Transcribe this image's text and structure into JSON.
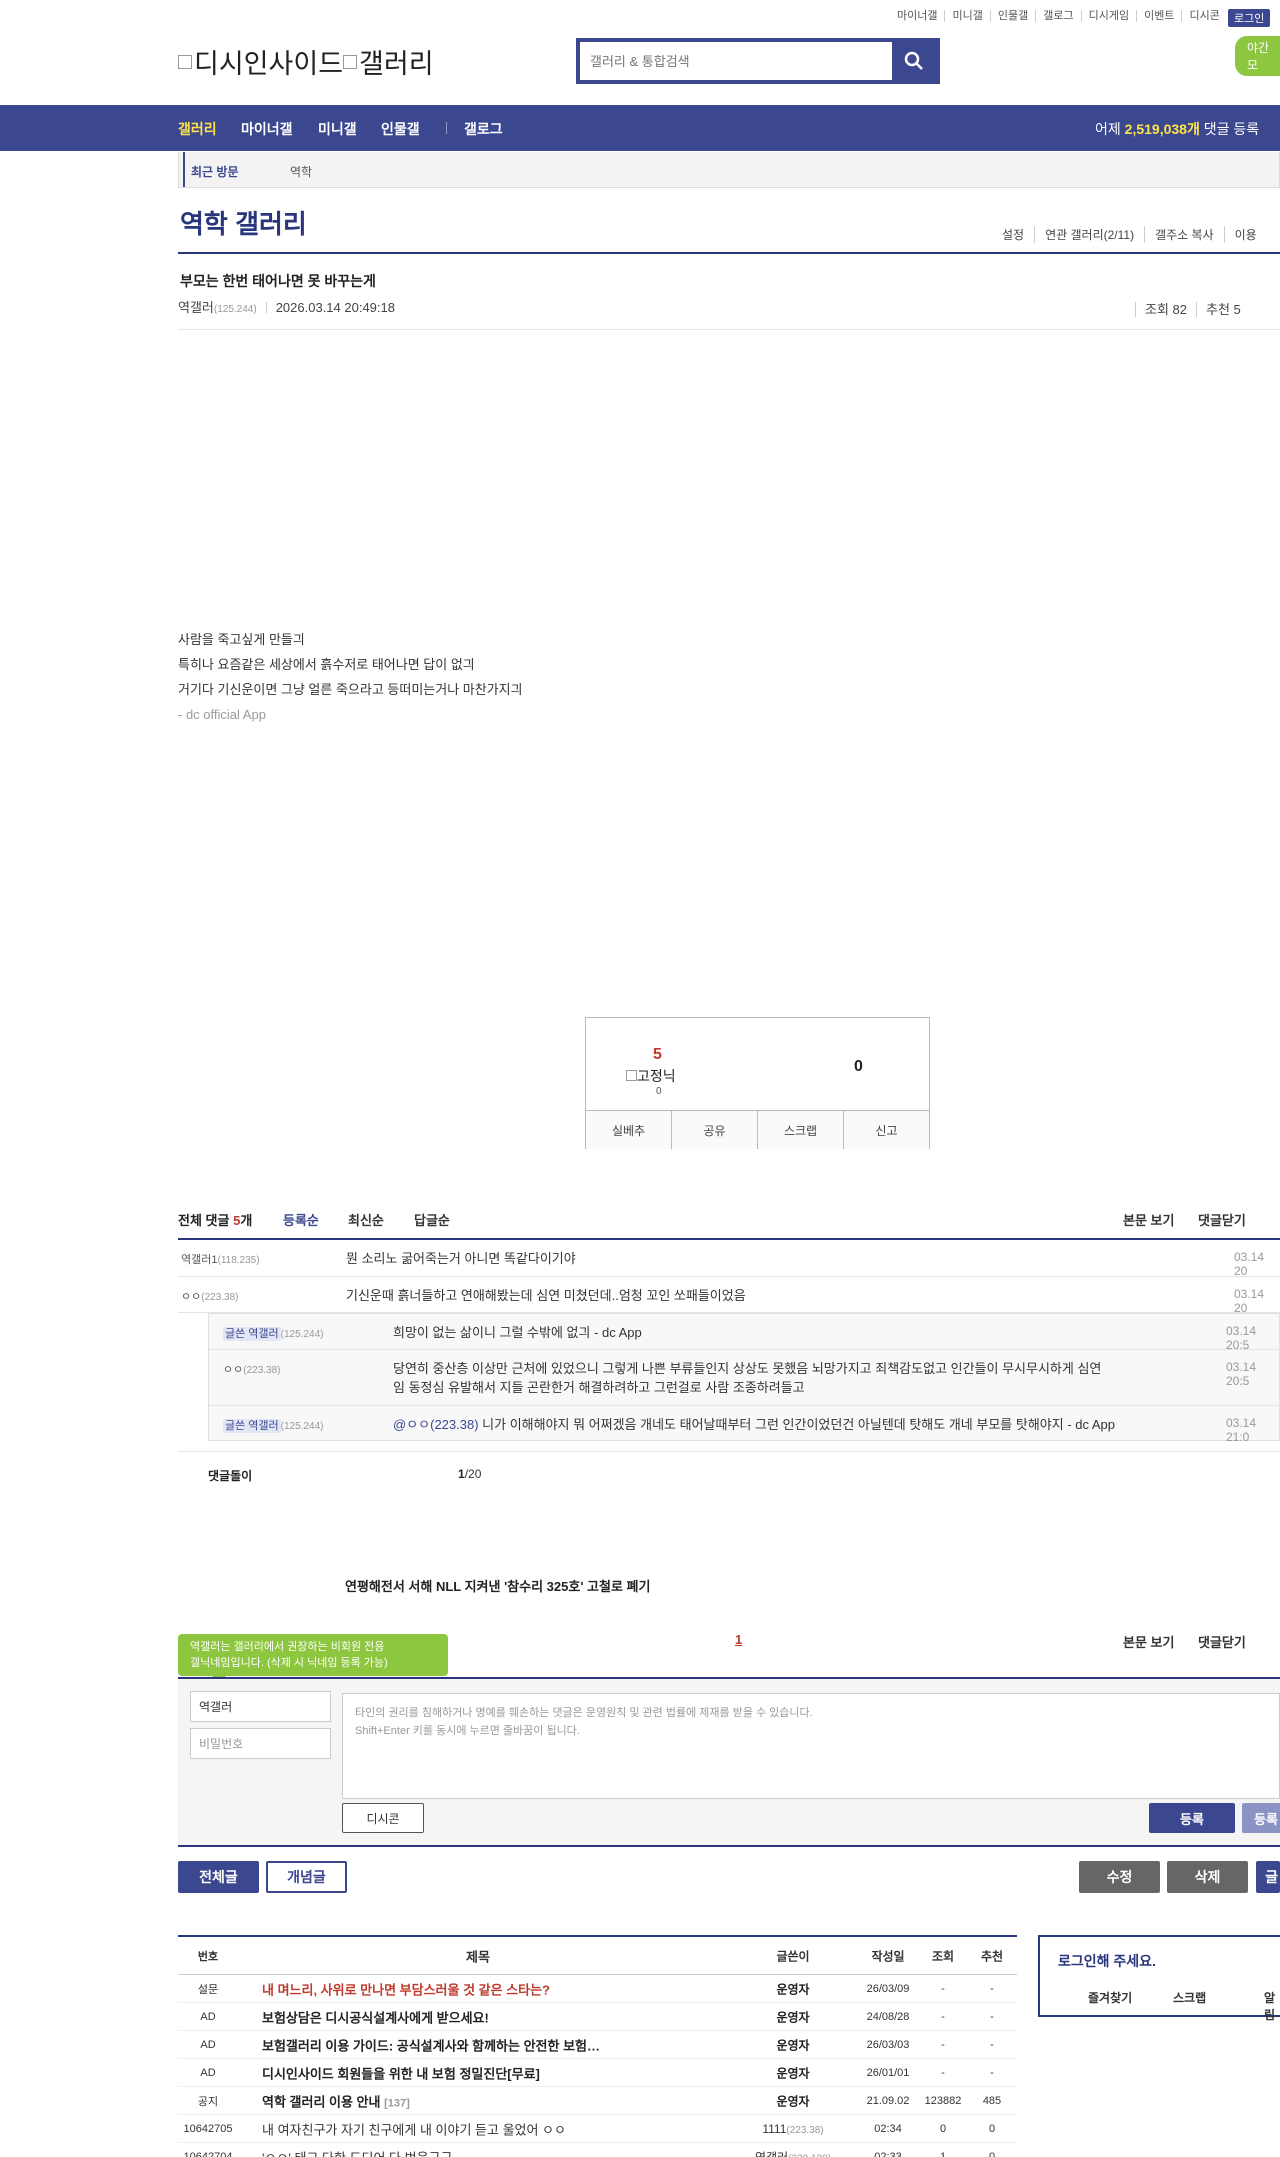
{
  "top_links": [
    "마이너갤",
    "미니갤",
    "인물갤",
    "갤로그",
    "디시게임",
    "이벤트",
    "디시콘"
  ],
  "login_label": "로그인",
  "night_label": "야간 모",
  "logo_alt": "디시인사이드",
  "logo_alt2": "갤러리",
  "search": {
    "placeholder": "갤러리 & 통합검색"
  },
  "gnb": {
    "items": [
      "갤러리",
      "마이너갤",
      "미니갤",
      "인물갤",
      "갤로그"
    ],
    "stat_prefix": "어제 ",
    "stat_value": "2,519,038개",
    "stat_suffix": " 댓글 등록"
  },
  "recent": {
    "label": "최근 방문",
    "value": "역학"
  },
  "gallery": {
    "title": "역학 갤러리",
    "menu": [
      "설정",
      "연관 갤러리(2/11)",
      "갤주소 복사",
      "이용"
    ]
  },
  "post": {
    "title": "부모는 한번 태어나면 못 바꾸는게",
    "author": "역갤러",
    "author_ip": "(125.244)",
    "datetime": "2026.03.14 20:49:18",
    "views": "조회 82",
    "recommends": "추천 5",
    "body": [
      "사람을 죽고싶게 만들긔",
      "특히나 요즘같은 세상에서 흙수저로 태어나면 답이 없긔",
      "거기다 기신운이면 그냥 얼른 죽으라고 등떠미는거나 마찬가지긔"
    ],
    "app_sign": "- dc official App"
  },
  "recommend_box": {
    "up_count": "5",
    "fixed_alt": "고정닉",
    "fixed_count": "0",
    "down_count": "0",
    "actions": [
      "실베추",
      "공유",
      "스크랩",
      "신고"
    ]
  },
  "comments": {
    "total_prefix": "전체 댓글 ",
    "total_count": "5",
    "total_suffix": "개",
    "sorts": [
      "등록순",
      "최신순",
      "답글순"
    ],
    "right_links": [
      "본문 보기",
      "댓글닫기"
    ],
    "items": [
      {
        "nick": "역갤러1",
        "ip": "(118.235)",
        "text": "뭔 소리노 굶어죽는거 아니면 똑같다이기야",
        "date": "03.14 20"
      },
      {
        "nick": "ㅇㅇ",
        "ip": "(223.38)",
        "text": "기신운때 흙너들하고 연애해봤는데 심연 미쳤던데..엄청 꼬인 쏘패들이었음",
        "date": "03.14 20"
      }
    ],
    "replies": [
      {
        "tag": "글쓴 역갤러",
        "ip": "(125.244)",
        "text": "희망이 없는 삶이니 그럴 수밖에 없긔 - dc App",
        "date": "03.14 20:5"
      },
      {
        "nick": "ㅇㅇ",
        "ip": "(223.38)",
        "text_line1": "당연히 중산층 이상만 근처에 있었으니 그렇게 나쁜 부류들인지 상상도 못했음 뇌망가지고 죄책감도없고 인간들이 무시무시하게 심연",
        "text_line2": "임 동정심 유발해서 지들 곤란한거 해결하려하고 그런걸로 사람 조종하려들고",
        "date": "03.14 20:5"
      },
      {
        "tag": "글쓴 역갤러",
        "ip": "(125.244)",
        "mention": "@ㅇㅇ(223.38)",
        "text": " 니가 이해해야지 뭐 어쩌겠음 개네도 태어날때부터 그런 인간이었던건 아닐텐데 탓해도 개네 부모를 탓해야지 - dc App",
        "date": "03.14 21:0"
      }
    ],
    "page_label": "댓글돌이",
    "page_current": "1",
    "page_total": "/20"
  },
  "next_post": "연평해전서 서해 NLL 지켜낸 '참수리 325호' 고철로 폐기",
  "write": {
    "tooltip_line1": "역갤러는 갤러리에서 권장하는 비회원 전용",
    "tooltip_line2": "갤닉네임입니다. (삭제 시 닉네임 등록 가능)",
    "page_num": "1",
    "right_links": [
      "본문 보기",
      "댓글닫기"
    ],
    "nick_value": "역갤러",
    "password_placeholder": "비밀번호",
    "notice_line1": "타인의 권리를 침해하거나 명예를 훼손하는 댓글은 운영원칙 및 관련 법률에 제재를 받을 수 있습니다.",
    "notice_line2": "Shift+Enter 키를 동시에 누르면 줄바꿈이 됩니다.",
    "dccon_label": "디시콘",
    "submit_label": "등록",
    "submit2_label": "등록"
  },
  "buttons": {
    "all": "전체글",
    "concept": "개념글",
    "edit": "수정",
    "delete": "삭제",
    "write": "글"
  },
  "list": {
    "headers": [
      "번호",
      "제목",
      "글쓴이",
      "작성일",
      "조회",
      "추천"
    ],
    "rows": [
      {
        "no": "설문",
        "title": "내 며느리, 사위로 만나면 부담스러울 것 같은 스타는?",
        "style": "red",
        "writer": "운영자",
        "date": "26/03/09",
        "views": "-",
        "rec": "-"
      },
      {
        "no": "AD",
        "title": "보험상담은 디시공식설계사에게 받으세요!",
        "style": "bold",
        "writer": "운영자",
        "date": "24/08/28",
        "views": "-",
        "rec": "-"
      },
      {
        "no": "AD",
        "title": "보험갤러리 이용 가이드: 공식설계사와 함께하는 안전한 보험…",
        "style": "bold",
        "writer": "운영자",
        "date": "26/03/03",
        "views": "-",
        "rec": "-"
      },
      {
        "no": "AD",
        "title": "디시인사이드 회원들을 위한 내 보험 정밀진단[무료]",
        "style": "bold",
        "writer": "운영자",
        "date": "26/01/01",
        "views": "-",
        "rec": "-"
      },
      {
        "no": "공지",
        "title": "역학 갤러리 이용 안내",
        "count": "[137]",
        "style": "bold",
        "writer": "운영자",
        "date": "21.09.02",
        "views": "123882",
        "rec": "485"
      },
      {
        "no": "10642705",
        "title": "내 여자친구가 자기 친구에게 내 이야기 듣고 울었어 ㅇㅇ",
        "style": "normal",
        "writer": "1111",
        "writer_ip": "(223.38)",
        "date": "02:34",
        "views": "0",
        "rec": "0"
      },
      {
        "no": "10642704",
        "title": "'ㅇㅇ' 태그 다한 도디어 다 벗음구구",
        "style": "normal",
        "writer": "역갤러",
        "writer_ip": "(220.120)",
        "date": "02:33",
        "views": "1",
        "rec": "0"
      }
    ]
  },
  "login_panel": {
    "title": "로그인해 주세요.",
    "menu": [
      "즐겨찾기",
      "스크랩",
      "알림"
    ]
  }
}
